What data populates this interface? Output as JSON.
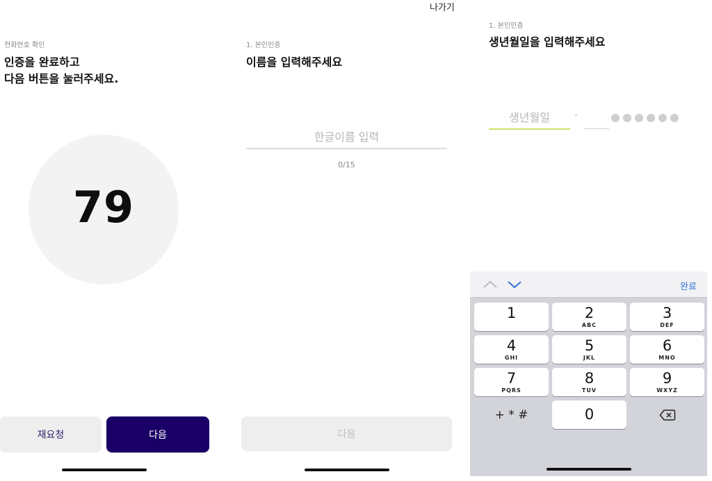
{
  "screen1": {
    "step": "전화번호 확인",
    "title_line1": "인증을 완료하고",
    "title_line2": "다음 버튼을 눌러주세요.",
    "code": "79",
    "retry_label": "재요청",
    "next_label": "다음"
  },
  "screen2": {
    "exit_label": "나가기",
    "step": "1. 본인인증",
    "title": "이름을 입력해주세요",
    "name_placeholder": "한글이름 입력",
    "counter": "0/15",
    "next_label": "다음"
  },
  "screen3": {
    "step": "1. 본인인증",
    "title": "생년월일을 입력해주세요",
    "birth_placeholder": "생년월일",
    "dash": "-",
    "masked_digits": 6,
    "keyboard": {
      "done_label": "완료",
      "up_icon": "chevron-up-icon",
      "down_icon": "chevron-down-icon",
      "keys": [
        {
          "num": "1",
          "letters": ""
        },
        {
          "num": "2",
          "letters": "ABC"
        },
        {
          "num": "3",
          "letters": "DEF"
        },
        {
          "num": "4",
          "letters": "GHI"
        },
        {
          "num": "5",
          "letters": "JKL"
        },
        {
          "num": "6",
          "letters": "MNO"
        },
        {
          "num": "7",
          "letters": "PQRS"
        },
        {
          "num": "8",
          "letters": "TUV"
        },
        {
          "num": "9",
          "letters": "WXYZ"
        }
      ],
      "symbols_label": "+ * #",
      "zero_label": "0",
      "backspace_icon": "backspace-icon"
    }
  },
  "colors": {
    "primary": "#1a0066",
    "input_focus": "#c8e26a",
    "done_blue": "#2f73d8"
  }
}
